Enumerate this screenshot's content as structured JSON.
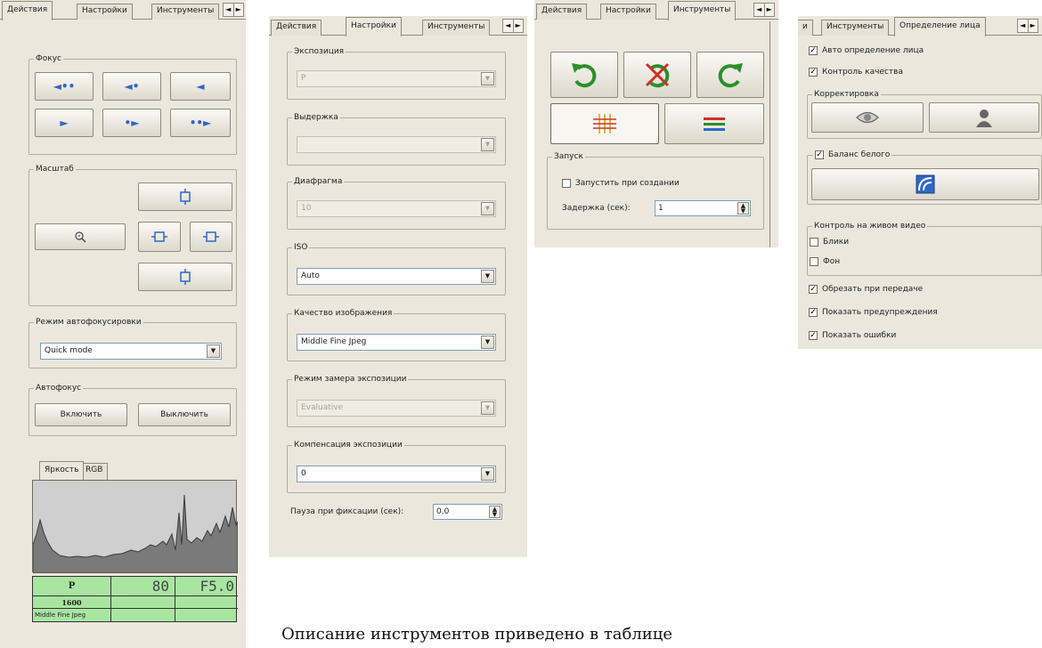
{
  "colors": {
    "panel_bg": "#ebe7dc",
    "arrow_blue": "#2f67c7",
    "lcd_green": "#a8e6a0",
    "rotate_green": "#2c8f2a"
  },
  "panel1": {
    "tabs": [
      "Действия",
      "Настройки",
      "Инструменты"
    ],
    "tab_scroll": {
      "left": "◄",
      "right": "►"
    },
    "focus": {
      "label": "Фокус",
      "buttons": [
        "◄••",
        "◄•",
        "◄",
        "►",
        "•►",
        "••►"
      ]
    },
    "scale": {
      "label": "Масштаб",
      "zoom_icon": "zoom-icon",
      "frame_icons": [
        "frame-top-icon",
        "frame-left-icon",
        "frame-right-icon",
        "frame-bottom-icon"
      ]
    },
    "af_mode": {
      "label": "Режим автофокусировки",
      "value": "Quick mode"
    },
    "autofocus": {
      "label": "Автофокус",
      "on": "Включить",
      "off": "Выключить"
    },
    "histogram": {
      "tabs": [
        "Яркость",
        "RGB"
      ]
    },
    "lcd": {
      "mode": "P",
      "shutter": "80",
      "aperture": "F5.0",
      "iso": "1600",
      "quality": "Middle Fine Jpeg"
    }
  },
  "panel2": {
    "tabs": [
      "Действия",
      "Настройки",
      "Инструменты"
    ],
    "exposure": {
      "label": "Экспозиция",
      "value": "P"
    },
    "shutter": {
      "label": "Выдержка",
      "value": ""
    },
    "aperture": {
      "label": "Диафрагма",
      "value": "10"
    },
    "iso": {
      "label": "ISO",
      "value": "Auto"
    },
    "quality": {
      "label": "Качество изображения",
      "value": "Middle Fine Jpeg"
    },
    "metering": {
      "label": "Режим замера экспозиции",
      "value": "Evaluative"
    },
    "compensation": {
      "label": "Компенсация экспозиции",
      "value": "0"
    },
    "pause": {
      "label": "Пауза при фиксации (сек):",
      "value": "0,0"
    }
  },
  "panel3": {
    "tabs": [
      "Действия",
      "Настройки",
      "Инструменты"
    ],
    "launch": {
      "label": "Запуск",
      "checkbox": "Запустить при создании",
      "checked": false,
      "delay_label": "Задержка (сек):",
      "delay_value": "1"
    }
  },
  "panel4": {
    "tabs": [
      "и",
      "Инструменты",
      "Определение лица"
    ],
    "auto_detect": {
      "label": "Авто определение лица",
      "checked": true
    },
    "quality_control": {
      "label": "Контроль качества",
      "checked": true
    },
    "correction": {
      "label": "Корректировка"
    },
    "white_balance": {
      "label": "Баланс белого",
      "checked": true
    },
    "live": {
      "label": "Контроль на живом видео",
      "blink": "Блики",
      "blink_checked": false,
      "bg": "Фон",
      "bg_checked": false
    },
    "crop": {
      "label": "Обрезать при передаче",
      "checked": true
    },
    "warnings": {
      "label": "Показать предупреждения",
      "checked": true
    },
    "errors": {
      "label": "Показать ошибки",
      "checked": true
    }
  },
  "caption": "Описание инструментов приведено в таблице"
}
